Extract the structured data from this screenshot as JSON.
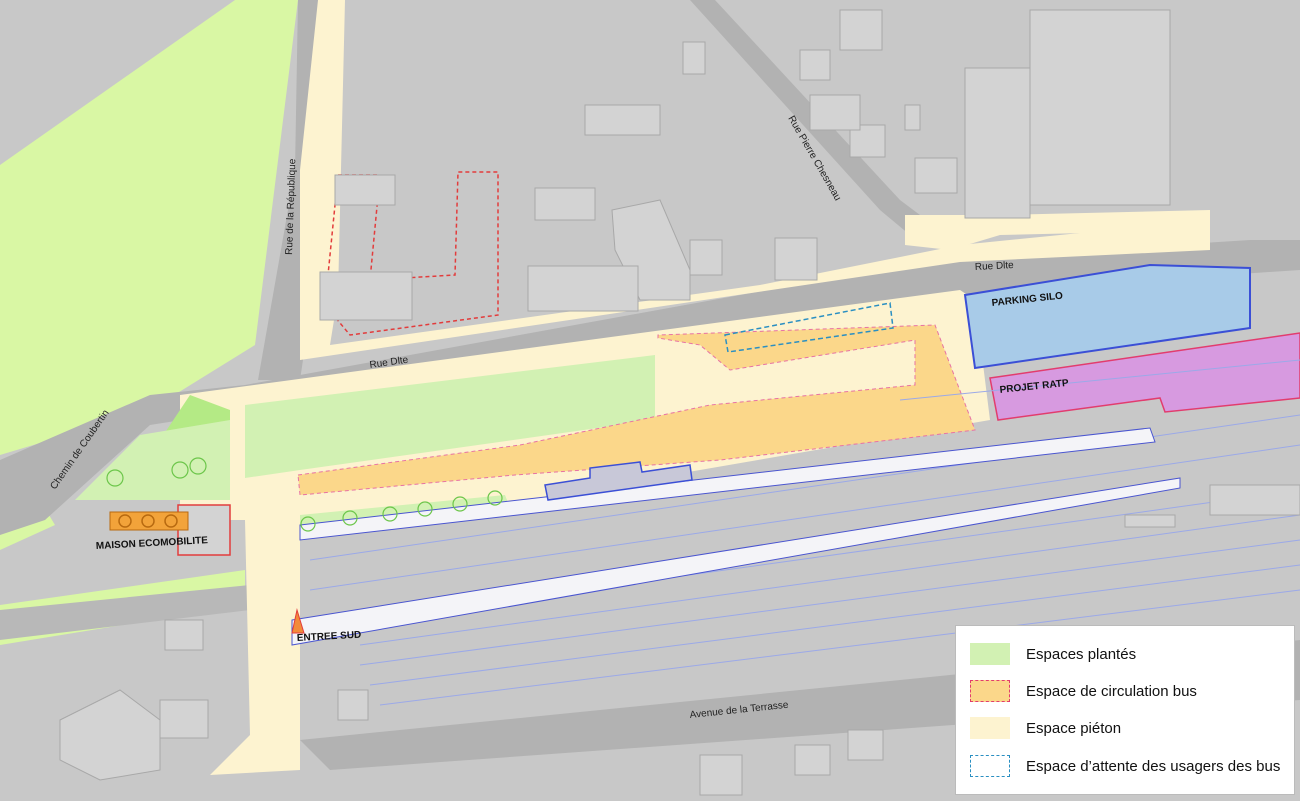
{
  "streets": {
    "rue_dlte_upper": "Rue Dlte",
    "rue_dlte_lower": "Rue Dlte",
    "rue_republique": "Rue de la République",
    "rue_chesneau": "Rue  Pierre Chesneau",
    "chemin_coubertin": "Chemin de Coubertin",
    "avenue_terrasse": "Avenue de la Terrasse"
  },
  "places": {
    "parking_silo": "PARKING SILO",
    "projet_ratp": "PROJET RATP",
    "maison_ecomobilite": "MAISON ECOMOBILITE",
    "entree_sud": "ENTREE SUD"
  },
  "legend": {
    "items": [
      {
        "label": "Espaces plantés",
        "fill": "#d2f1b3",
        "border": "none"
      },
      {
        "label": "Espace de circulation bus",
        "fill": "#fbd78a",
        "border": "dashed #e23c6e"
      },
      {
        "label": "Espace piéton",
        "fill": "#fdf3d0",
        "border": "none"
      },
      {
        "label": "Espace d’attente des usagers des bus",
        "fill": "#ffffff",
        "border": "dashed #2a8fc2"
      }
    ]
  },
  "colors": {
    "background": "#c8c8c8",
    "planted": "#d2f1b3",
    "bus_circulation": "#fbd78a",
    "pedestrian": "#fdf3d0",
    "parking_silo": "#a8cbe8",
    "projet_ratp": "#d79ae0",
    "road": "#b2b2b2",
    "platform": "#f4f4f8"
  }
}
